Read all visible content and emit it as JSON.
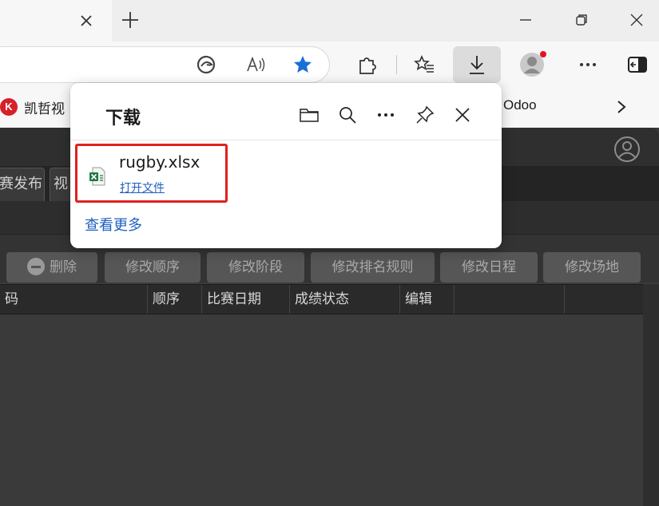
{
  "bookmarks": {
    "first": "凯哲视",
    "first_logo": "K",
    "odoo": "Odoo"
  },
  "app": {
    "tabs": [
      "赛发布",
      "视"
    ],
    "actions": [
      "删除",
      "修改顺序",
      "修改阶段",
      "修改排名规则",
      "修改日程",
      "修改场地"
    ],
    "columns": [
      "码",
      "顺序",
      "比赛日期",
      "成绩状态",
      "编辑",
      ""
    ]
  },
  "download_panel": {
    "title": "下载",
    "file_name": "rugby.xlsx",
    "open_file": "打开文件",
    "see_more": "查看更多"
  },
  "colors": {
    "accent": "#1f5fbf",
    "highlight_box": "#e0201c",
    "favorite_star": "#1a6fd6",
    "notification_dot": "#e81123"
  }
}
